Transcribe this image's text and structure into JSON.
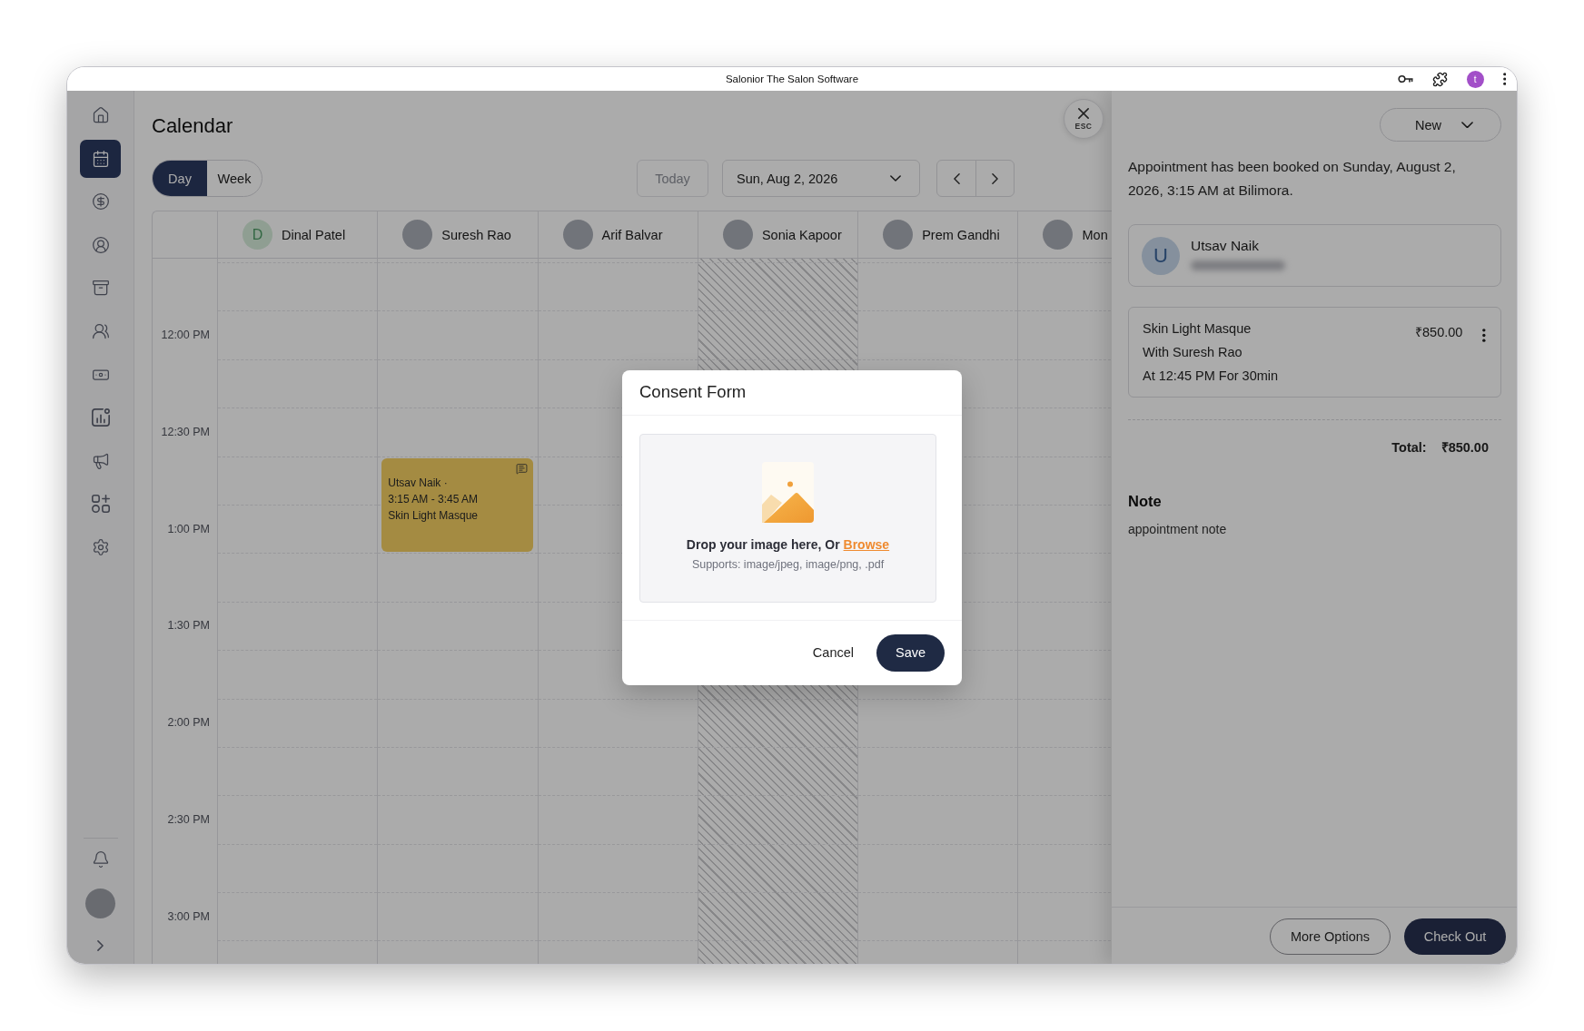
{
  "window": {
    "title": "Salonior The Salon Software",
    "profile_initial": "t"
  },
  "sidebar": {
    "items": [
      {
        "selected": false
      },
      {
        "selected": true
      },
      {
        "selected": false
      },
      {
        "selected": false
      },
      {
        "selected": false
      },
      {
        "selected": false
      },
      {
        "selected": false
      },
      {
        "selected": false
      },
      {
        "selected": false
      },
      {
        "selected": false
      },
      {
        "selected": false
      }
    ]
  },
  "header": {
    "title": "Calendar"
  },
  "view_toggle": [
    {
      "label": "Day",
      "selected": true
    },
    {
      "label": "Week",
      "selected": false
    }
  ],
  "toolbar": {
    "today": {
      "label": "Today",
      "disabled": true
    },
    "date": "Sun, Aug 2, 2026"
  },
  "calendar": {
    "staff": [
      {
        "kind": "letter",
        "initial": "D",
        "name": "Dinal Patel",
        "unavailable": false
      },
      {
        "kind": "photo",
        "name": "Suresh Rao",
        "unavailable": false,
        "appointments": [
          {
            "client": "Utsav Naik ·",
            "time": "3:15 AM - 3:45 AM",
            "service": "Skin Light Masque",
            "has_note": true
          }
        ]
      },
      {
        "kind": "photo",
        "name": "Arif Balvar",
        "unavailable": false
      },
      {
        "kind": "photo",
        "name": "Sonia Kapoor",
        "unavailable": true
      },
      {
        "kind": "photo",
        "name": "Prem Gandhi",
        "unavailable": false
      },
      {
        "kind": "photo",
        "name": "Mon",
        "unavailable": false
      }
    ],
    "times": [
      "12:00 PM",
      "12:30 PM",
      "1:00 PM",
      "1:30 PM",
      "2:00 PM",
      "2:30 PM",
      "3:00 PM"
    ]
  },
  "drawer": {
    "close_label": "ESC",
    "status": "New",
    "message": "Appointment has been booked on Sunday, August 2, 2026, 3:15 AM at Bilimora.",
    "client": {
      "initial": "U",
      "name": "Utsav Naik"
    },
    "services": [
      {
        "name": "Skin Light Masque",
        "staff": "With Suresh Rao",
        "time": "At 12:45 PM For 30min",
        "price": "₹850.00"
      }
    ],
    "total": {
      "label": "Total:",
      "value": "₹850.00"
    },
    "note": {
      "title": "Note",
      "text": "appointment note"
    },
    "buttons": [
      {
        "label": "More Options",
        "kind": "outline"
      },
      {
        "label": "Check Out",
        "kind": "primary"
      }
    ]
  },
  "modal": {
    "title": "Consent Form",
    "dropzone": {
      "prompt": "Drop your image here, Or",
      "link": "Browse",
      "hint": "Supports: image/jpeg, image/png, .pdf"
    },
    "buttons": [
      {
        "label": "Cancel",
        "kind": "text"
      },
      {
        "label": "Save",
        "kind": "primary"
      }
    ]
  }
}
